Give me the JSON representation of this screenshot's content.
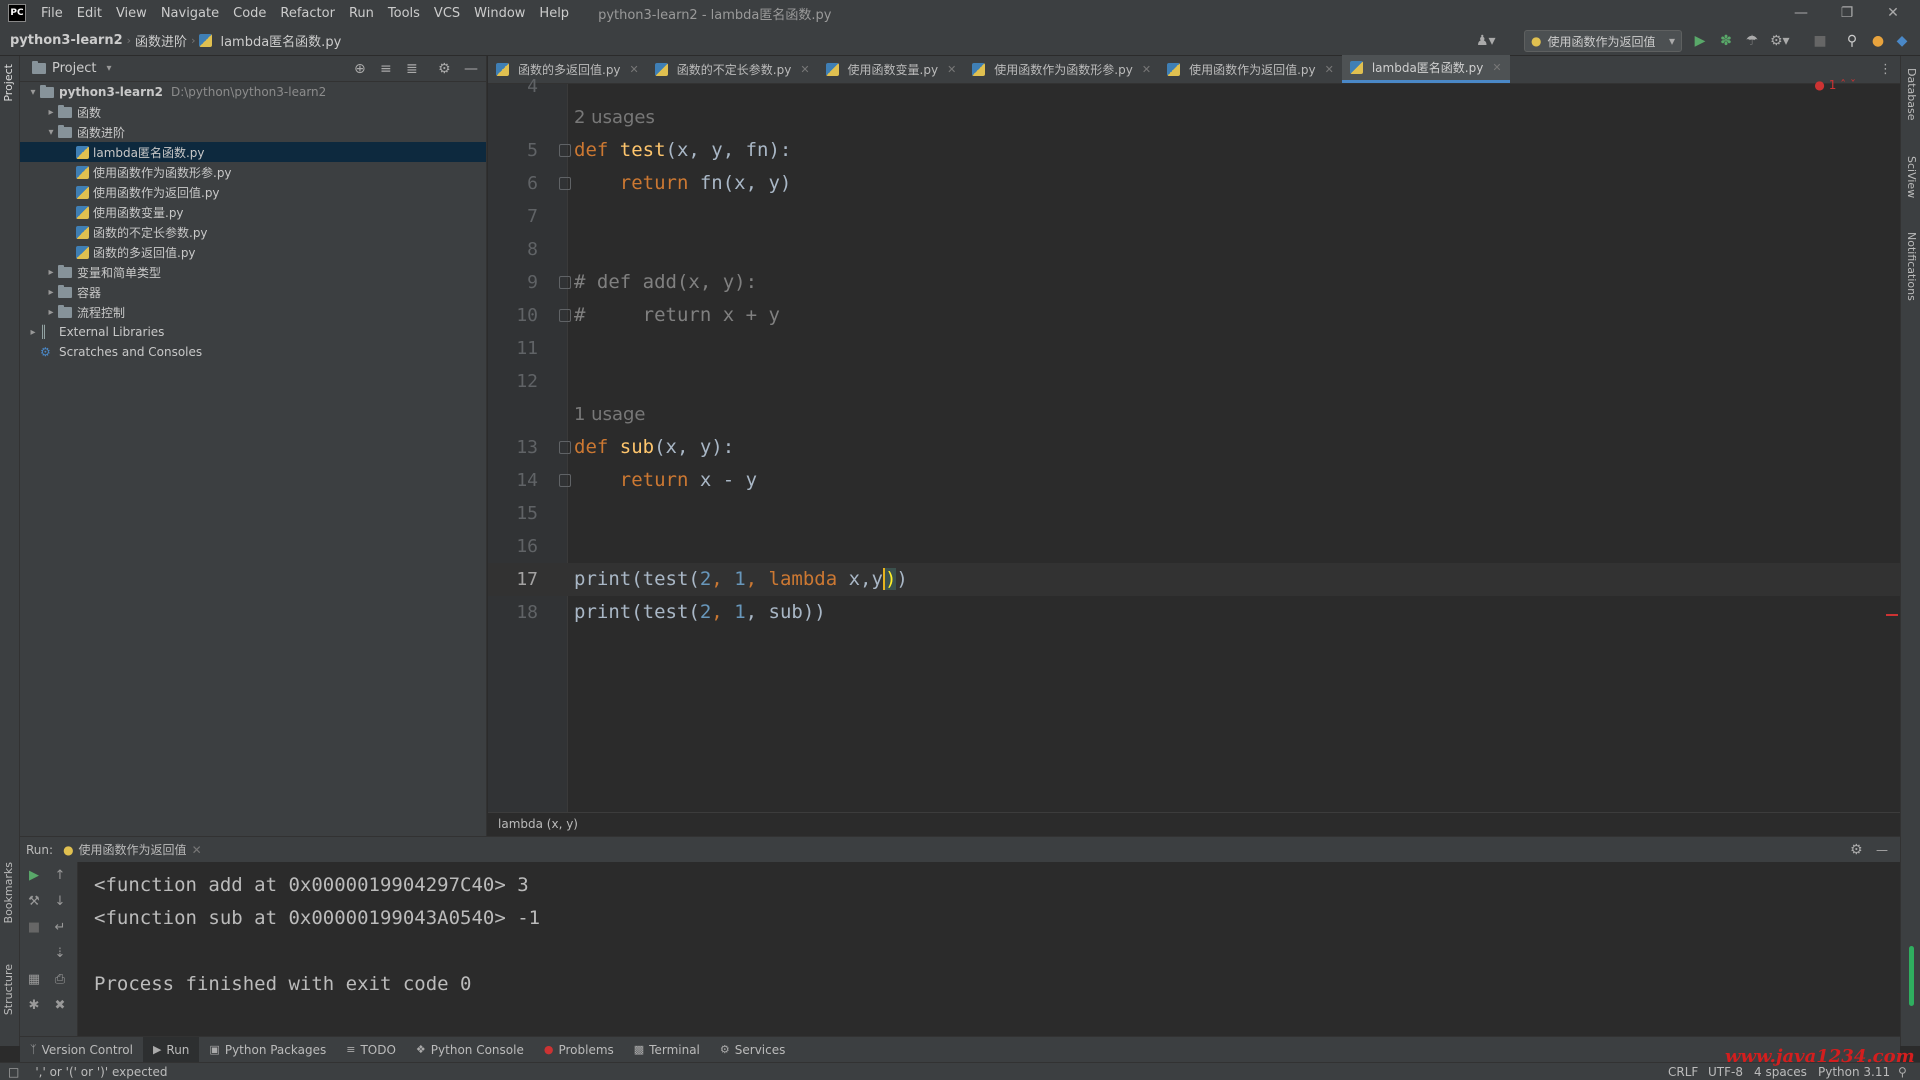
{
  "app": {
    "logo": "PC",
    "window_title": "python3-learn2 - lambda匿名函数.py",
    "menu": [
      "File",
      "Edit",
      "View",
      "Navigate",
      "Code",
      "Refactor",
      "Run",
      "Tools",
      "VCS",
      "Window",
      "Help"
    ]
  },
  "navbar": {
    "breadcrumbs": [
      "python3-learn2",
      "函数进阶",
      "lambda匿名函数.py"
    ],
    "run_config": "使用函数作为返回值"
  },
  "project": {
    "header": "Project",
    "side_label": "Project",
    "tree": [
      {
        "label": "python3-learn2",
        "hint": "D:\\python\\python3-learn2",
        "type": "folder",
        "depth": 0,
        "expanded": true
      },
      {
        "label": "函数",
        "type": "folder",
        "depth": 1,
        "expanded": false
      },
      {
        "label": "函数进阶",
        "type": "folder",
        "depth": 1,
        "expanded": true
      },
      {
        "label": "lambda匿名函数.py",
        "type": "py",
        "depth": 2,
        "selected": true
      },
      {
        "label": "使用函数作为函数形参.py",
        "type": "py",
        "depth": 2
      },
      {
        "label": "使用函数作为返回值.py",
        "type": "py",
        "depth": 2
      },
      {
        "label": "使用函数变量.py",
        "type": "py",
        "depth": 2
      },
      {
        "label": "函数的不定长参数.py",
        "type": "py",
        "depth": 2
      },
      {
        "label": "函数的多返回值.py",
        "type": "py",
        "depth": 2
      },
      {
        "label": "变量和简单类型",
        "type": "folder",
        "depth": 1,
        "expanded": false
      },
      {
        "label": "容器",
        "type": "folder",
        "depth": 1,
        "expanded": false
      },
      {
        "label": "流程控制",
        "type": "folder",
        "depth": 1,
        "expanded": false
      },
      {
        "label": "External Libraries",
        "type": "lib",
        "depth": 0,
        "expanded": false
      },
      {
        "label": "Scratches and Consoles",
        "type": "scratch",
        "depth": 0
      }
    ]
  },
  "editor": {
    "tabs": [
      {
        "label": "函数的多返回值.py",
        "active": false
      },
      {
        "label": "函数的不定长参数.py",
        "active": false
      },
      {
        "label": "使用函数变量.py",
        "active": false
      },
      {
        "label": "使用函数作为函数形参.py",
        "active": false
      },
      {
        "label": "使用函数作为返回值.py",
        "active": false
      },
      {
        "label": "lambda匿名函数.py",
        "active": true
      }
    ],
    "error_count": "1",
    "line_numbers": [
      "4",
      "5",
      "6",
      "7",
      "8",
      "9",
      "10",
      "11",
      "12",
      "13",
      "14",
      "15",
      "16",
      "17",
      "18"
    ],
    "usage_hints": [
      "2 usages",
      "1 usage"
    ],
    "code": {
      "l5": [
        "def",
        "test",
        "(x, y, fn):"
      ],
      "l6": [
        "return",
        " fn(x, y)"
      ],
      "l9": "# def add(x, y):",
      "l10": "#     return x + y",
      "l13": [
        "def",
        "sub",
        "(x, y):"
      ],
      "l14": [
        "return",
        " x - y"
      ],
      "l17": [
        "print(test(",
        "2",
        ", ",
        "1",
        ", ",
        "lambda",
        " x,y",
        ")",
        ")"
      ],
      "l18": [
        "print(test(",
        "2",
        ", ",
        "1",
        ", sub))"
      ]
    },
    "breadcrumb": "lambda (x, y)"
  },
  "run": {
    "label": "Run:",
    "tab": "使用函数作为返回值",
    "output": [
      "<function add at 0x0000019904297C40> 3",
      "<function sub at 0x00000199043A0540> -1",
      "",
      "Process finished with exit code 0"
    ]
  },
  "side_labels": {
    "bookmarks": "Bookmarks",
    "structure": "Structure",
    "database": "Database",
    "sciview": "SciView",
    "notifications": "Notifications"
  },
  "bottom_tools": [
    {
      "label": "Version Control",
      "icon": "branch-icon"
    },
    {
      "label": "Run",
      "icon": "play-icon",
      "active": true
    },
    {
      "label": "Python Packages",
      "icon": "package-icon"
    },
    {
      "label": "TODO",
      "icon": "list-icon"
    },
    {
      "label": "Python Console",
      "icon": "console-icon"
    },
    {
      "label": "Problems",
      "icon": "error-icon"
    },
    {
      "label": "Terminal",
      "icon": "terminal-icon"
    },
    {
      "label": "Services",
      "icon": "services-icon"
    }
  ],
  "status": {
    "message": "',' or '(' or ')' expected",
    "line_sep": "CRLF",
    "encoding": "UTF-8",
    "indent": "4 spaces",
    "interpreter": "Python 3.11",
    "watermark": "www.java1234.com"
  }
}
